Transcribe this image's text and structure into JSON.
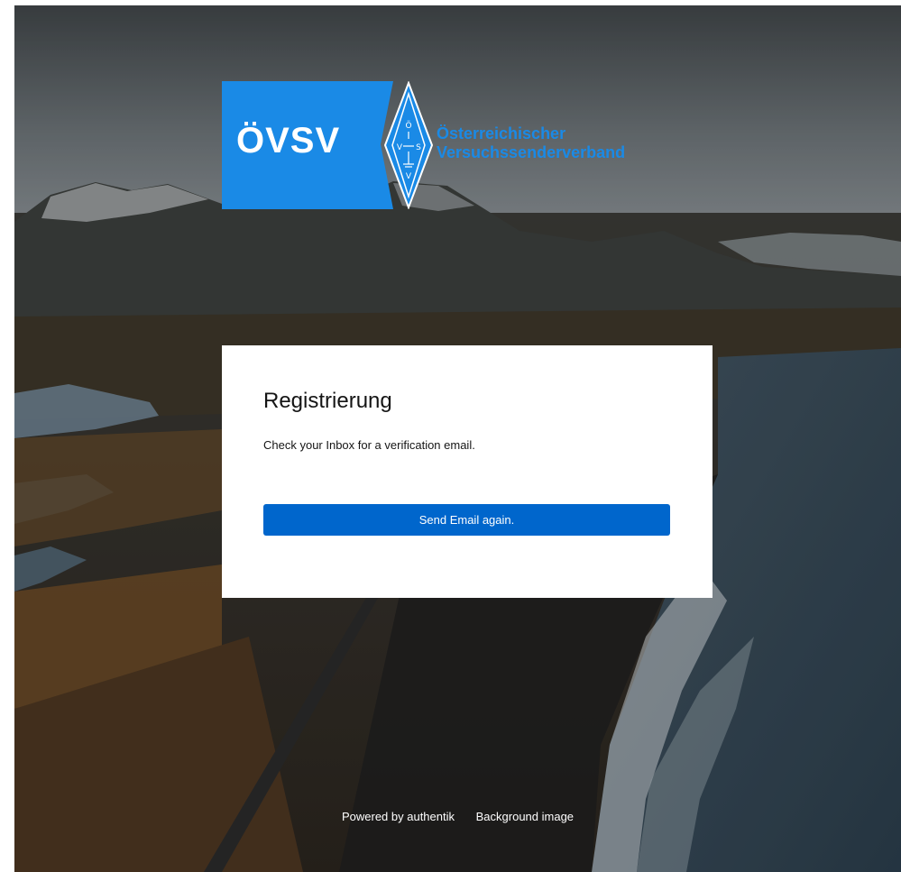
{
  "logo": {
    "abbr": "ÖVSV",
    "name_line1": "Österreichischer",
    "name_line2": "Versuchssenderverband"
  },
  "card": {
    "title": "Registrierung",
    "message": "Check your Inbox for a verification email.",
    "button_label": "Send Email again."
  },
  "footer": {
    "powered_by": "Powered by authentik",
    "background_link": "Background image"
  },
  "colors": {
    "brand_blue": "#1a8ae6",
    "button_blue": "#0066cc"
  },
  "icons": {
    "emblem": "ovsv-diamond-emblem"
  }
}
